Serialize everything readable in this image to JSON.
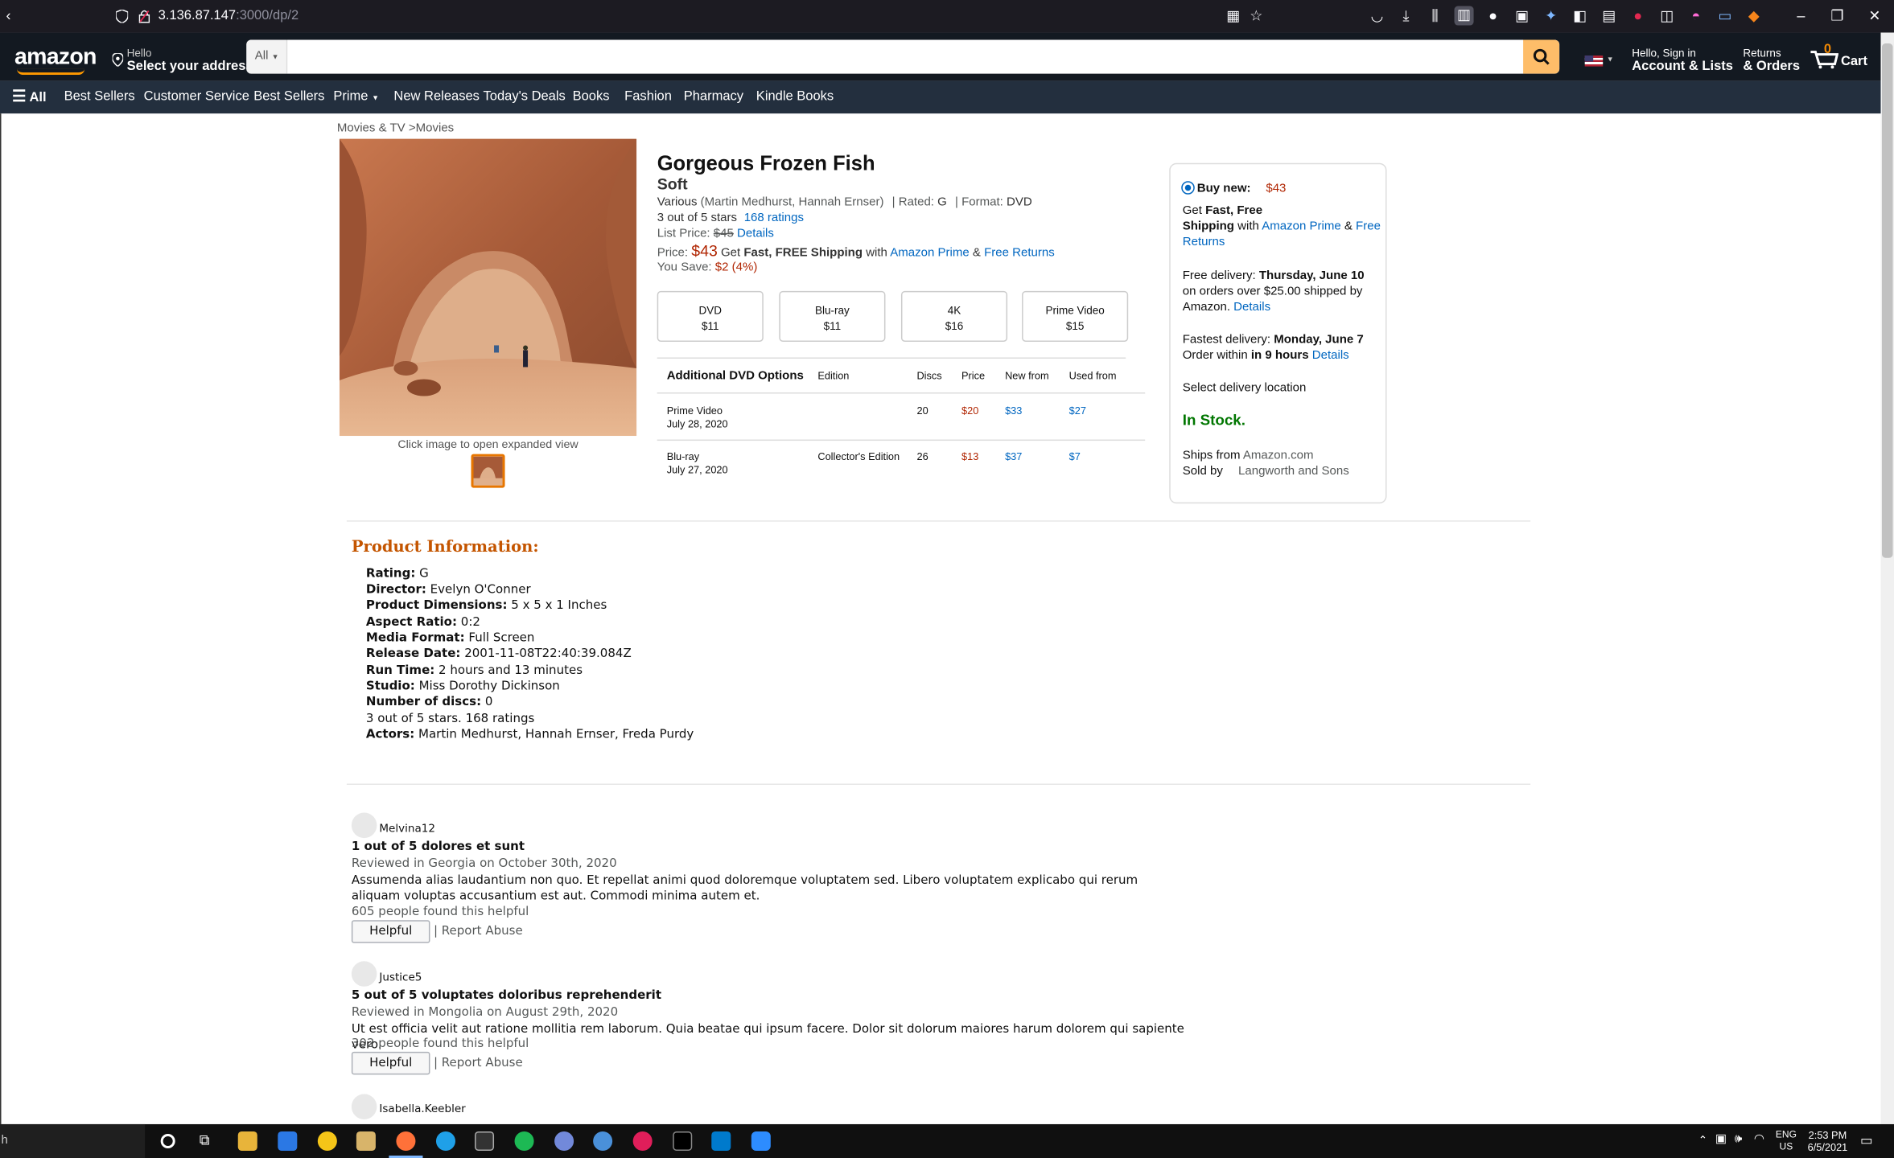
{
  "browser": {
    "url_host": "3.136.87.147",
    "url_path": ":3000/dp/2"
  },
  "header": {
    "logo": "amazon",
    "address_small": "Hello",
    "address_big": "Select your address",
    "search_category": "All",
    "search_placeholder": "",
    "account_small": "Hello, Sign in",
    "account_big": "Account & Lists",
    "returns_small": "Returns",
    "returns_big": "& Orders",
    "cart_count": "0",
    "cart_label": "Cart"
  },
  "subnav": {
    "all_label": "All",
    "items": [
      "Best Sellers",
      "Customer Service",
      "Best Sellers",
      "Prime",
      "New Releases",
      "Today's Deals",
      "Books",
      "Fashion",
      "Pharmacy",
      "Kindle Books"
    ]
  },
  "breadcrumb": "Movies & TV >Movies",
  "image_caption": "Click image to open expanded view",
  "product": {
    "title": "Gorgeous Frozen Fish",
    "subtitle": "Soft",
    "byline_various": "Various",
    "byline_people": "(Martin Medhurst, Hannah Ernser)",
    "rated_label": "Rated:",
    "rated_value": "G",
    "format_label": "Format:",
    "format_value": "DVD",
    "stars_text": "3 out of 5 stars",
    "ratings_link": "168 ratings",
    "list_price_label": "List Price:",
    "list_price": "$45",
    "details_link": "Details",
    "price_label": "Price:",
    "price": "$43",
    "get_text": "Get",
    "fast_free": "Fast, FREE Shipping",
    "with_text": "with",
    "amazon_prime": "Amazon Prime",
    "amp": "&",
    "free_returns": "Free Returns",
    "save_label": "You Save:",
    "save_value": "$2",
    "save_pct": "(4%)"
  },
  "formats": [
    {
      "name": "DVD",
      "price": "$11"
    },
    {
      "name": "Blu-ray",
      "price": "$11"
    },
    {
      "name": "4K",
      "price": "$16"
    },
    {
      "name": "Prime Video",
      "price": "$15"
    }
  ],
  "options": {
    "headers": [
      "Additional DVD Options",
      "Edition",
      "Discs",
      "Price",
      "New from",
      "Used from"
    ],
    "rows": [
      {
        "format": "Prime Video",
        "date": "July 28, 2020",
        "edition": "",
        "discs": "20",
        "price": "$20",
        "new": "$33",
        "used": "$27"
      },
      {
        "format": "Blu-ray",
        "date": "July 27, 2020",
        "edition": "Collector's Edition",
        "discs": "26",
        "price": "$13",
        "new": "$37",
        "used": "$7"
      }
    ]
  },
  "buybox": {
    "buy_new": "Buy new:",
    "price": "$43",
    "get": "Get",
    "fast_free": "Fast, Free",
    "shipping": "Shipping",
    "with": "with",
    "amazon_prime": "Amazon Prime",
    "amp": "&",
    "free": "Free",
    "returns": "Returns",
    "free_delivery": "Free delivery:",
    "delivery_date": "Thursday, June 10",
    "orders_over": "on orders over $25.00 shipped by",
    "amazon": "Amazon.",
    "details": "Details",
    "fastest": "Fastest delivery:",
    "fastest_date": "Monday, June 7",
    "order_within": "Order within",
    "hours": "in 9 hours",
    "details2": "Details",
    "select_location": "Select delivery location",
    "in_stock": "In Stock.",
    "ships_from_label": "Ships from",
    "ships_from": "Amazon.com",
    "sold_by_label": "Sold by",
    "sold_by": "Langworth and Sons"
  },
  "product_info": {
    "heading": "Product Information:",
    "rows": [
      {
        "label": "Rating:",
        "value": "G"
      },
      {
        "label": "Director:",
        "value": "Evelyn O'Conner"
      },
      {
        "label": "Product Dimensions:",
        "value": "5 x 5 x 1 Inches"
      },
      {
        "label": "Aspect Ratio:",
        "value": "0:2"
      },
      {
        "label": "Media Format:",
        "value": "Full Screen"
      },
      {
        "label": "Release Date:",
        "value": "2001-11-08T22:40:39.084Z"
      },
      {
        "label": "Run Time:",
        "value": "2 hours and 13 minutes"
      },
      {
        "label": "Studio:",
        "value": "Miss Dorothy Dickinson"
      },
      {
        "label": "Number of discs:",
        "value": "0"
      },
      {
        "label": "",
        "value": "3 out of 5 stars. 168 ratings"
      },
      {
        "label": "Actors:",
        "value": "Martin Medhurst, Hannah Ernser, Freda Purdy"
      }
    ]
  },
  "reviews": [
    {
      "user": "Melvina12",
      "title": "1 out of 5 dolores et sunt",
      "meta": "Reviewed in Georgia on October 30th, 2020",
      "body": "Assumenda alias laudantium non quo. Et repellat animi quod doloremque voluptatem sed. Libero voluptatem explicabo qui rerum aliquam voluptas accusantium est aut. Commodi minima autem et.",
      "helpful_count": "605 people found this helpful",
      "helpful_btn": "Helpful",
      "report": "| Report Abuse"
    },
    {
      "user": "Justice5",
      "title": "5 out of 5 voluptates doloribus reprehenderit",
      "meta": "Reviewed in Mongolia on August 29th, 2020",
      "body": "Ut est officia velit aut ratione mollitia rem laborum. Quia beatae qui ipsum facere. Dolor sit dolorum maiores harum dolorem qui sapiente vero.",
      "helpful_count": "302 people found this helpful",
      "helpful_btn": "Helpful",
      "report": "| Report Abuse"
    },
    {
      "user": "Isabella.Keebler"
    }
  ],
  "taskbar": {
    "search_stub": "h",
    "lang1": "ENG",
    "lang2": "US",
    "time": "2:53 PM",
    "date": "6/5/2021"
  },
  "colors": {
    "nav_bg": "#131921",
    "subnav_bg": "#232f3e",
    "search_btn": "#febd69",
    "link": "#0066c0",
    "price": "#b12704",
    "in_stock": "#007600",
    "pi_heading": "#c45500"
  }
}
